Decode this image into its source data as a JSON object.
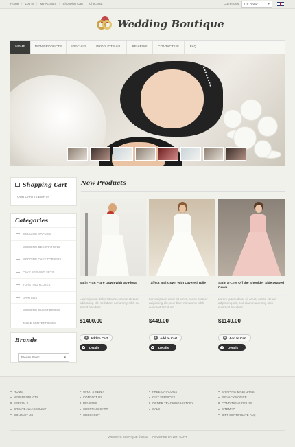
{
  "top_links": [
    "Home",
    "Log In",
    "My Account",
    "Shopping Cart",
    "Checkout"
  ],
  "currencies": {
    "label": "Currencies:",
    "selected": "US Dollar"
  },
  "logo": {
    "text": "Wedding Boutique"
  },
  "nav": [
    "Home",
    "New Products",
    "Specials",
    "Products All",
    "Reviews",
    "Contact Us",
    "FAQ"
  ],
  "shopping_cart": {
    "title": "Shopping Cart",
    "status": "Your cart is empty"
  },
  "categories": {
    "title": "Categories",
    "items": [
      "Wedding Napkins",
      "Wedding Decorations",
      "Wedding Cake Toppers",
      "Cake Serving Sets",
      "Toasting Flutes",
      "Garters",
      "Wedding Guest Books",
      "Table Centerpieces"
    ]
  },
  "brands": {
    "title": "Brands",
    "selected": "Please Select"
  },
  "new_products": {
    "title": "New Products",
    "items": [
      {
        "name": "Satin Fit & Flare Gown with 3D Floral",
        "desc": "Lorem ipsum dolor sit amet, conse ctetuer adipiscing elit, sed diam nonummy nibh eu ismod tincidunt.",
        "price": "$1400.00"
      },
      {
        "name": "Taffeta Ball Gown with Layered Tulle",
        "desc": "Lorem ipsum dolor sit amet, conse ctetuer adipiscing elit, sed diam nonummy nibh euismod tincidunt.",
        "price": "$449.00"
      },
      {
        "name": "Satin A-Line Off the Shoulder Side Draped Gown",
        "desc": "Lorem ipsum dolor sit amet, conse ctetuer adipiscing elit, sed diam nonummy nibh euismod tincidunt.",
        "price": "$1149.00"
      }
    ],
    "add_label": "Add to Cart",
    "details_label": "Details"
  },
  "footer": {
    "col1": [
      "Home",
      "New Products",
      "Specials",
      "Create an Account",
      "Contact Us"
    ],
    "col2": [
      "What's New?",
      "Contact Us",
      "Reviews",
      "Shopping Cart",
      "Checkout"
    ],
    "col3": [
      "Free Catalogs",
      "Gift Services",
      "Order Tracking History",
      "Sale"
    ],
    "col4": [
      "Shipping & Returns",
      "Privacy Notice",
      "Conditions of Use",
      "Sitemap",
      "Gift Certificate FAQ"
    ],
    "copyright": "Wedding Boutique © 2011",
    "powered": "Powered by Zen Cart"
  },
  "colors": {
    "accent": "#3a3a38",
    "background": "#f1f1ec",
    "footer": "#ecece6"
  }
}
